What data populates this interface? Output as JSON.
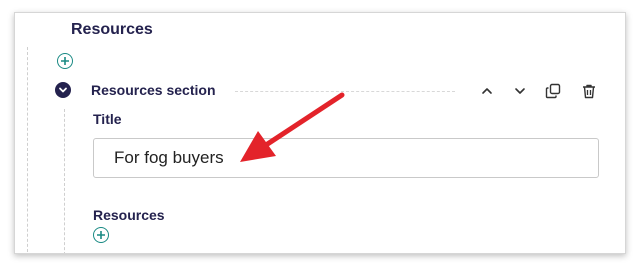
{
  "page": {
    "heading": "Resources"
  },
  "section": {
    "title": "Resources section"
  },
  "fields": {
    "title_label": "Title",
    "title_value": "For fog buyers",
    "resources_label": "Resources"
  },
  "icons": {
    "add": "plus-circle-icon",
    "collapse": "chevron-down-circle-icon",
    "move_up": "chevron-up-icon",
    "move_down": "chevron-down-icon",
    "duplicate": "copy-icon",
    "delete": "trash-icon",
    "annotation": "red-arrow-icon"
  },
  "colors": {
    "heading": "#24224e",
    "accent_teal": "#1a8a84",
    "annotation_red": "#e3232a"
  }
}
